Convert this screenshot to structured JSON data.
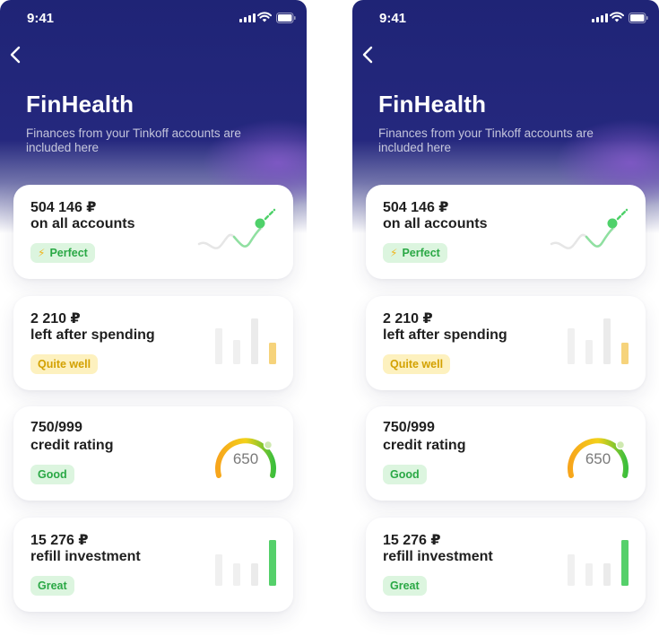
{
  "status": {
    "time": "9:41"
  },
  "header": {
    "title": "FinHealth",
    "subtitle": "Finances from your Tinkoff accounts are included here"
  },
  "cards": [
    {
      "value": "504 146 ₽",
      "description": "on all accounts",
      "badge": "Perfect",
      "badge_icon": "lightning-icon",
      "badge_color": "#2aa845",
      "illustration": "trend-line-icon"
    },
    {
      "value": "2 210 ₽",
      "description": "left after spending",
      "badge": "Quite well",
      "badge_color": "#d3a100",
      "illustration": "bar-chart-icon",
      "bar_levels": [
        0.62,
        0.52,
        1.0,
        0.48
      ]
    },
    {
      "value": "750/999",
      "description": "credit rating",
      "badge": "Good",
      "badge_color": "#2aa845",
      "illustration": "gauge-icon",
      "gauge_value": "650"
    },
    {
      "value": "15 276 ₽",
      "description": "refill investment",
      "badge": "Great",
      "badge_color": "#2aa845",
      "illustration": "bar-chart-icon",
      "bar_levels": [
        0.65,
        0.48,
        0.48,
        1.0
      ]
    }
  ]
}
